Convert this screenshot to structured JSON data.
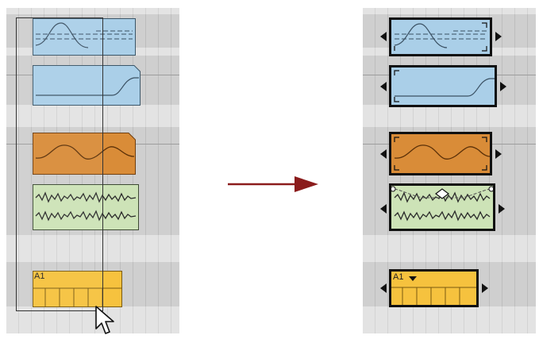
{
  "colors": {
    "automation_blue": "#aacfe8",
    "automation_orange": "#d98c38",
    "audio_green": "#cde3b7",
    "midi_yellow": "#f6c23e",
    "arrow_red": "#8b1c1c"
  },
  "left": {
    "midi_clip_label": "A1"
  },
  "right": {
    "midi_clip_label": "A1"
  },
  "icons": {
    "cursor": "mouse-pointer-icon",
    "transition": "arrow-right-icon",
    "menu": "triangle-down-icon"
  }
}
